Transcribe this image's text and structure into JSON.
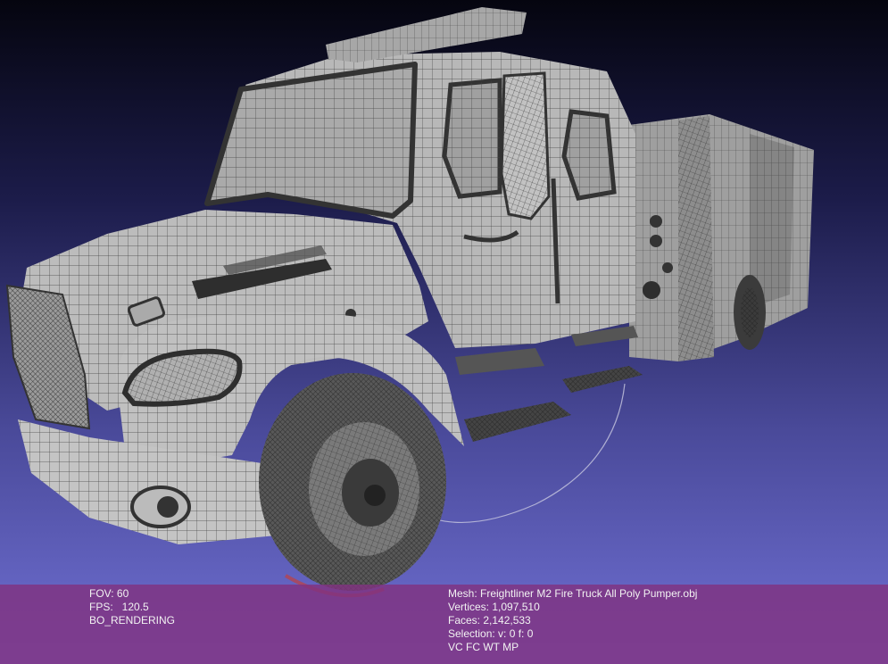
{
  "viewer": {
    "stats_left": {
      "fov": "FOV: 60",
      "fps": "FPS:   120.5",
      "mode": "BO_RENDERING"
    },
    "stats_right": {
      "mesh": "Mesh: Freightliner M2 Fire Truck All Poly Pumper.obj",
      "vertices": "Vertices: 1,097,510",
      "faces": "Faces: 2,142,533",
      "selection": "Selection: v: 0 f: 0",
      "flags": "VC FC WT MP"
    }
  },
  "colors": {
    "background_top": "#05050f",
    "background_bottom": "#7070d4",
    "mesh_fill": "#b8b8b8",
    "wire": "#3a3a3a",
    "info_bar": "#803280",
    "trackball_ring": "#c8c8e0"
  }
}
